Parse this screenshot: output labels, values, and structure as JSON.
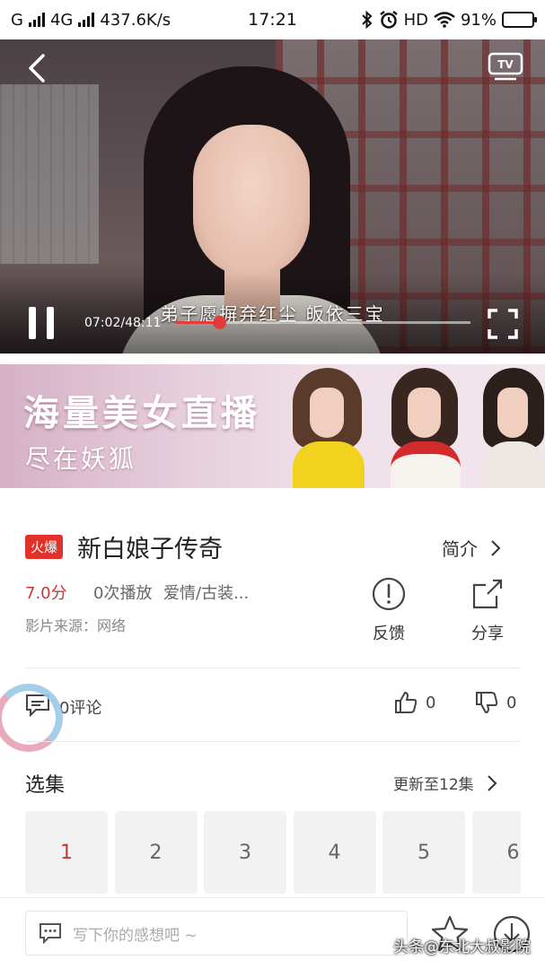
{
  "status_bar": {
    "carrier": "G",
    "network": "4G",
    "speed": "437.6K/s",
    "time": "17:21",
    "hd": "HD",
    "battery": "91%",
    "battery_level": 0.91
  },
  "player": {
    "subtitle": "弟子愿摒弃红尘 皈依三宝",
    "time_label": "07:02/48:11",
    "progress": 0.146,
    "icons": [
      "back-icon",
      "tv-cast-icon",
      "pause-icon",
      "fullscreen-icon"
    ]
  },
  "banner": {
    "title": "海量美女直播",
    "subtitle": "尽在妖狐"
  },
  "show": {
    "badge": "火爆",
    "title": "新白娘子传奇",
    "intro_label": "简介",
    "rating": "7.0分",
    "plays": "0次播放",
    "genre": "爱情/古装...",
    "source": "影片来源：网络",
    "feedback_label": "反馈",
    "share_label": "分享"
  },
  "social": {
    "comments": "0评论",
    "likes": "0",
    "dislikes": "0"
  },
  "episodes": {
    "title": "选集",
    "update": "更新至12集",
    "items": [
      "1",
      "2",
      "3",
      "4",
      "5",
      "6"
    ],
    "active_index": 0
  },
  "bottom_bar": {
    "placeholder": "写下你的感想吧 ~",
    "watermark": "头条@东北大叔影院"
  },
  "colors": {
    "accent_red": "#e2302b",
    "rating_red": "#c23a3a",
    "progress_red": "#e23b3b"
  }
}
